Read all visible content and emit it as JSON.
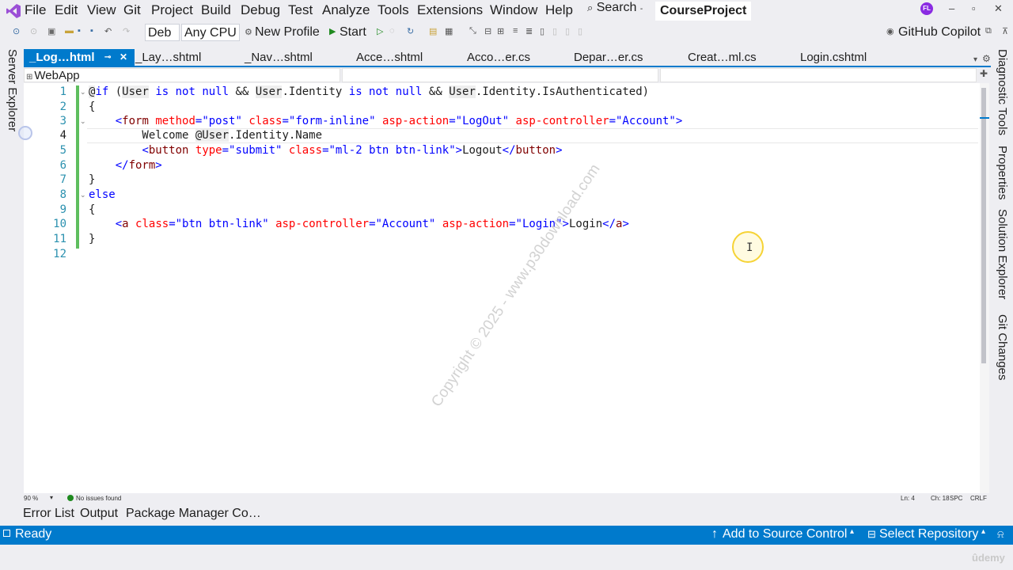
{
  "menu": {
    "items": [
      "File",
      "Edit",
      "View",
      "Git",
      "Project",
      "Build",
      "Debug",
      "Test",
      "Analyze",
      "Tools",
      "Extensions",
      "Window",
      "Help"
    ],
    "search_label": "Search",
    "solution_name": "CourseProject",
    "avatar_initials": "FL"
  },
  "toolbar": {
    "config": "Deb",
    "platform": "Any CPU",
    "profile": "New Profile",
    "start": "Start",
    "copilot": "GitHub Copilot"
  },
  "tabs": [
    {
      "label": "_Log…html",
      "active": true
    },
    {
      "label": "_Lay…shtml",
      "active": false
    },
    {
      "label": "_Nav…shtml",
      "active": false
    },
    {
      "label": "Acce…shtml",
      "active": false
    },
    {
      "label": "Acco…er.cs",
      "active": false
    },
    {
      "label": "Depar…er.cs",
      "active": false
    },
    {
      "label": "Creat…ml.cs",
      "active": false
    },
    {
      "label": "Login.cshtml",
      "active": false
    }
  ],
  "navbar": {
    "project": "WebApp"
  },
  "editor": {
    "line_numbers": [
      "1",
      "2",
      "3",
      "4",
      "5",
      "6",
      "7",
      "8",
      "9",
      "10",
      "11",
      "12"
    ],
    "current_line": "4",
    "watermark": "Copyright © 2025 - www.p30download.com"
  },
  "side_panels": {
    "left": [
      "Server Explorer"
    ],
    "right": [
      "Diagnostic Tools",
      "Properties",
      "Solution Explorer",
      "Git Changes"
    ]
  },
  "editor_status": {
    "zoom": "90 %",
    "issues": "No issues found",
    "line": "Ln: 4",
    "col": "Ch: 18",
    "spacing": "SPC",
    "eol": "CRLF"
  },
  "bottom_tabs": [
    "Error List",
    "Output",
    "Package Manager Co…"
  ],
  "statusbar": {
    "ready": "Ready",
    "add_source": "Add to Source Control",
    "select_repo": "Select Repository"
  },
  "branding": {
    "udemy": "ûdemy"
  },
  "colors": {
    "accent": "#007acc",
    "keyword": "#0000ff",
    "tag": "#800000",
    "attribute": "#ff0000",
    "line_number": "#2b91af"
  }
}
